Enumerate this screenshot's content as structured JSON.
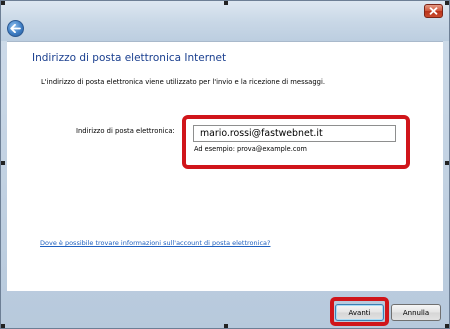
{
  "window": {
    "close_icon": "close-icon",
    "back_icon": "back-arrow-icon"
  },
  "page": {
    "heading": "Indirizzo di posta elettronica Internet",
    "description": "L'indirizzo di posta elettronica viene utilizzato per l'invio e la ricezione di messaggi."
  },
  "email": {
    "label": "Indirizzo di posta elettronica:",
    "value": "mario.rossi@fastwebnet.it",
    "example": "Ad esempio: prova@example.com"
  },
  "help_link": "Dove è possibile trovare informazioni sull'account di posta elettronica?",
  "buttons": {
    "next": "Avanti",
    "cancel": "Annulla"
  },
  "colors": {
    "heading": "#1a3f8f",
    "link": "#1d5fbf",
    "highlight": "#d0151a",
    "close_button": "#c94a2e"
  }
}
